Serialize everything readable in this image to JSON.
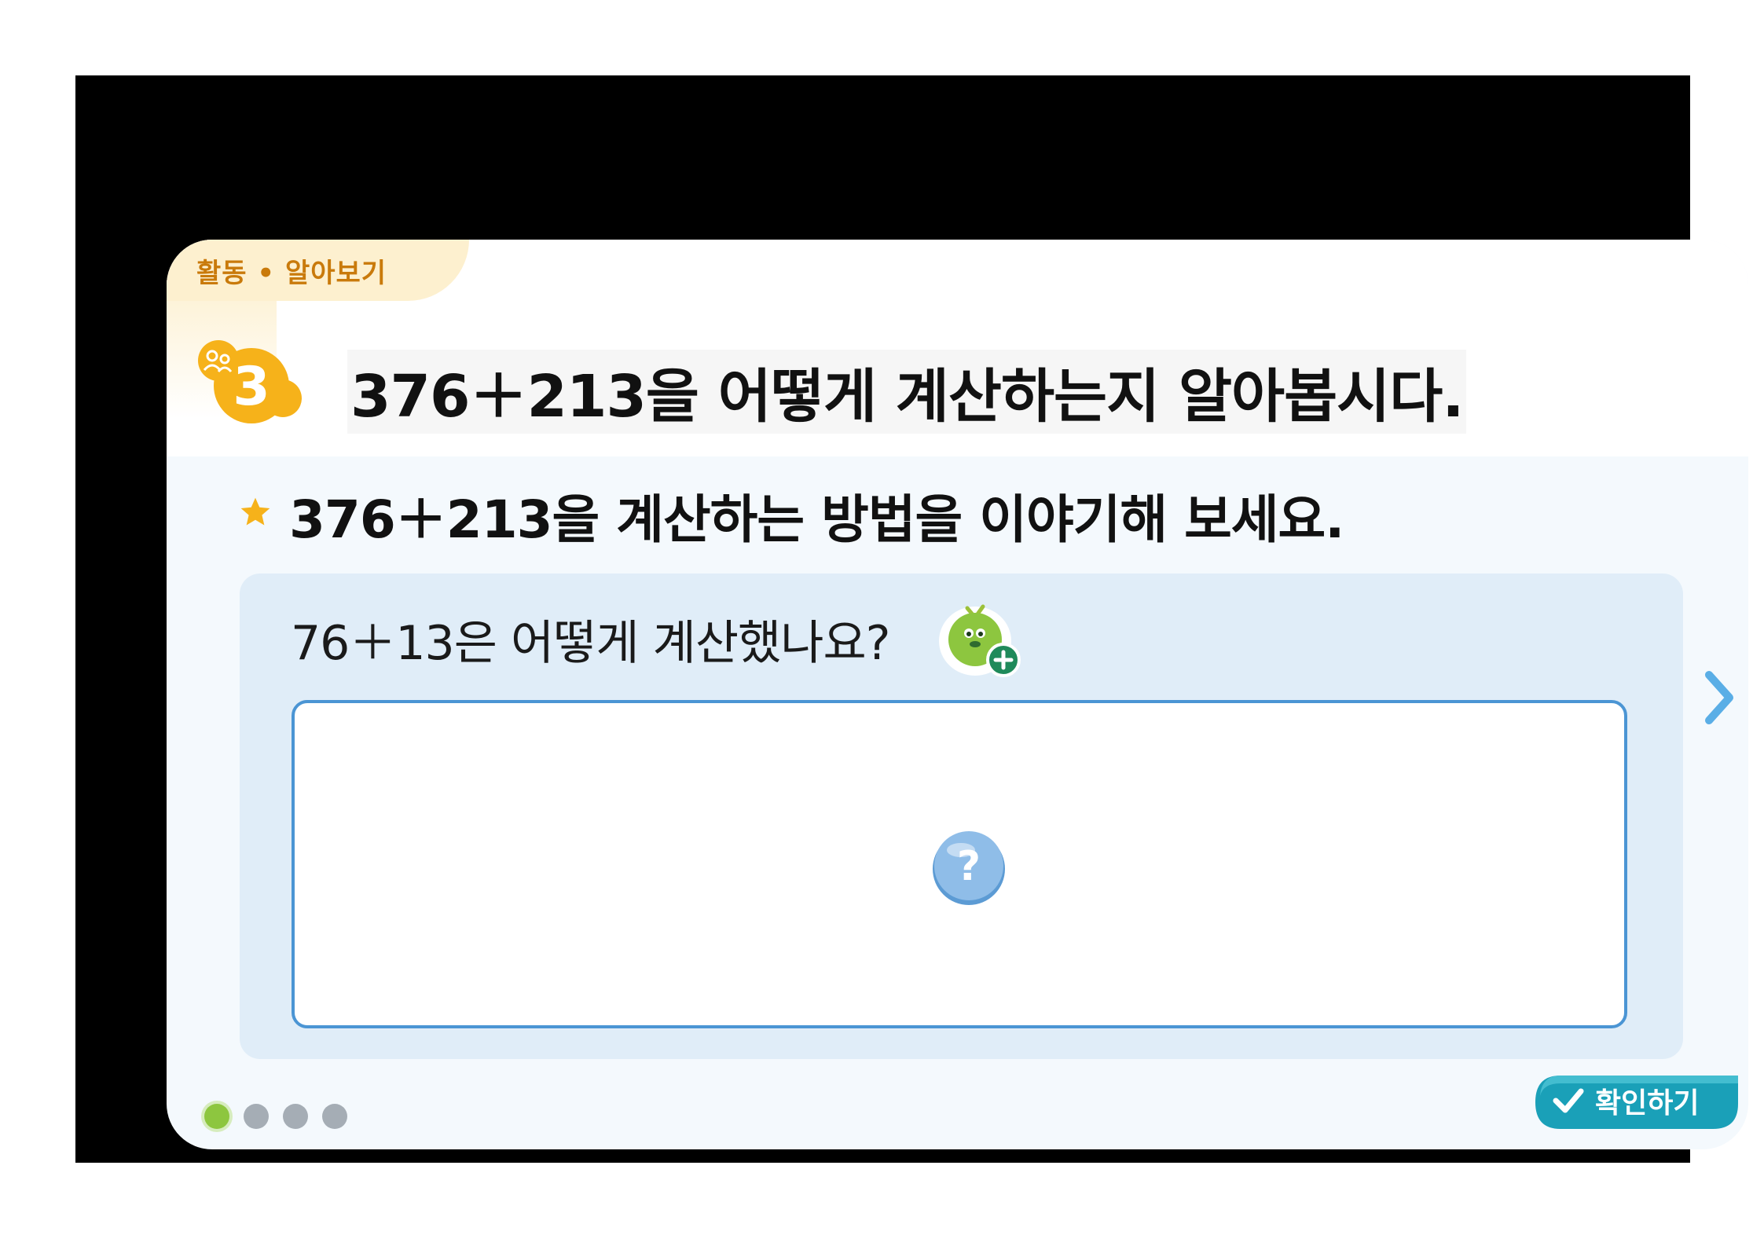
{
  "header": {
    "activity_tag": "활동 • 알아보기",
    "step_number": "3",
    "title": "376＋213을 어떻게 계산하는지 알아봅시다."
  },
  "task": {
    "prompt": "376＋213을 계산하는 방법을 이야기해 보세요."
  },
  "question": {
    "text": "76＋13은 어떻게 계산했나요?",
    "reveal_symbol": "?"
  },
  "navigation": {
    "page_count": 4,
    "current_page": 1
  },
  "footer": {
    "confirm_label": "확인하기"
  },
  "colors": {
    "accent_orange": "#f6b21a",
    "tag_text": "#c97a0b",
    "answer_border": "#4b95d4",
    "active_dot": "#8dc63f",
    "confirm_button": "#1aa0b8"
  },
  "icons": [
    "people-icon",
    "star-icon",
    "hint-character-icon",
    "question-mark-icon",
    "chevron-right-icon",
    "check-icon"
  ]
}
